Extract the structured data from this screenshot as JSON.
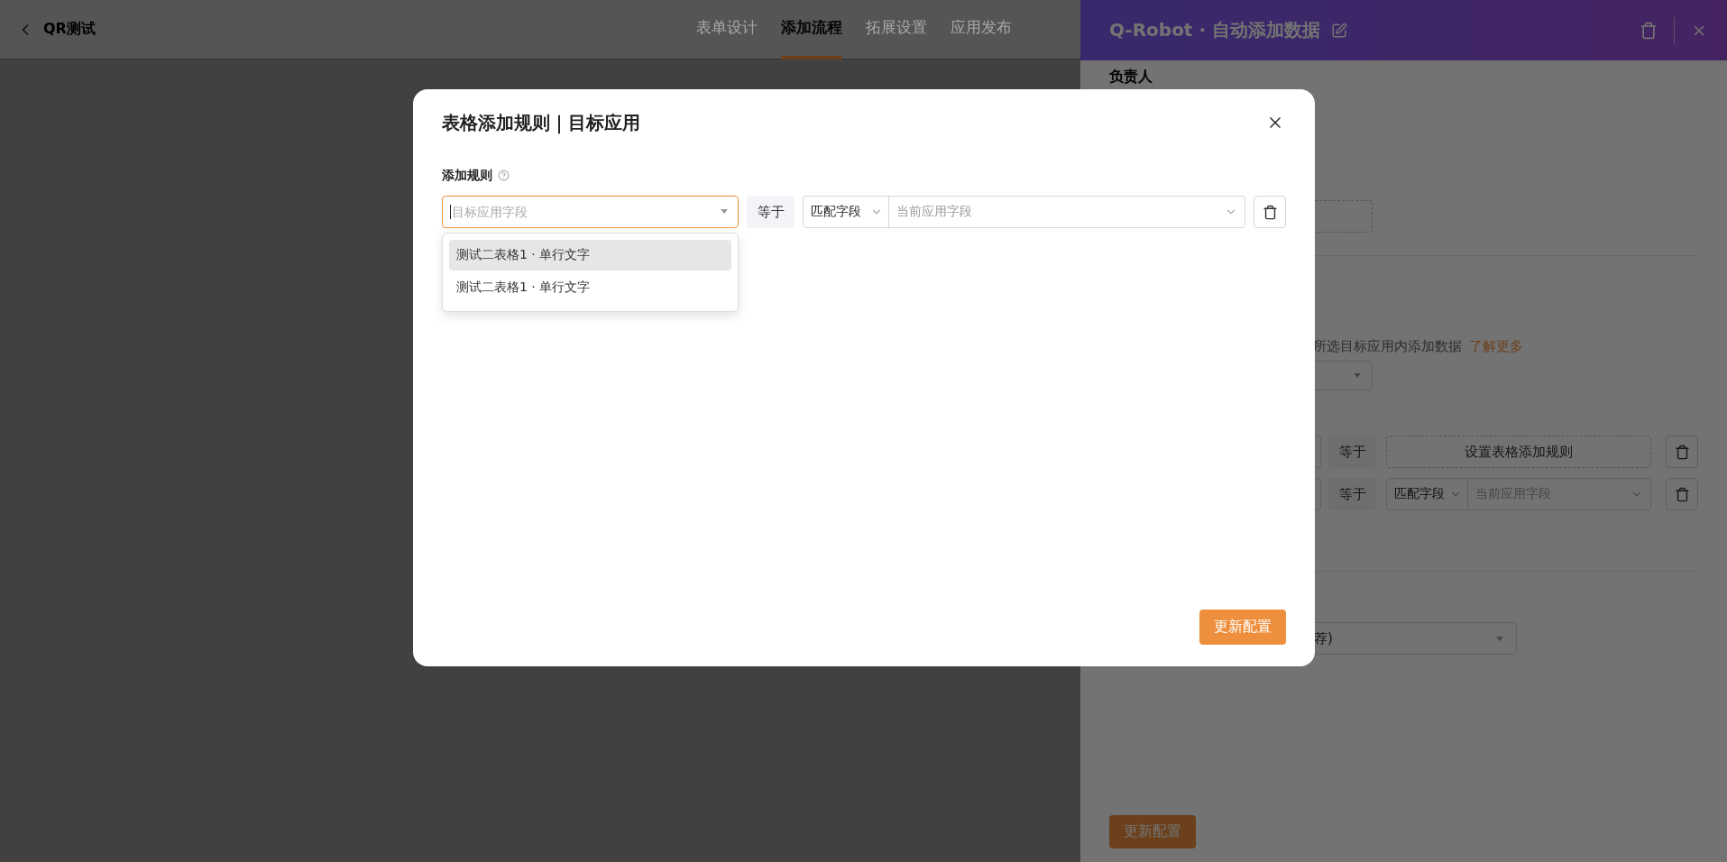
{
  "top_bar": {
    "app_title": "QR测试",
    "tabs": [
      {
        "label": "表单设计",
        "selected": false
      },
      {
        "label": "添加流程",
        "selected": true
      },
      {
        "label": "拓展设置",
        "selected": false
      },
      {
        "label": "应用发布",
        "selected": false
      }
    ]
  },
  "drawer": {
    "title": "Q-Robot · 自动添加数据",
    "owner_label": "负责人",
    "info_text": "所选目标应用内添加数据",
    "info_link": "了解更多",
    "rules": [
      {
        "kind": "placeholder",
        "operator": "等于",
        "text": "设置表格添加规则"
      },
      {
        "kind": "match",
        "operator": "等于",
        "match_type": "匹配字段",
        "placeholder": "当前应用字段"
      }
    ],
    "select_value": "荐)",
    "submit": "更新配置"
  },
  "modal": {
    "title": "表格添加规则｜目标应用",
    "rule_label": "添加规则",
    "target_field": {
      "placeholder": "目标应用字段",
      "focused": true
    },
    "options": [
      {
        "label": "测试二表格1 · 单行文字",
        "highlighted": true
      },
      {
        "label": "测试二表格1 · 单行文字",
        "highlighted": false
      }
    ],
    "operator": "等于",
    "match_type": "匹配字段",
    "source_placeholder": "当前应用字段",
    "submit": "更新配置"
  }
}
